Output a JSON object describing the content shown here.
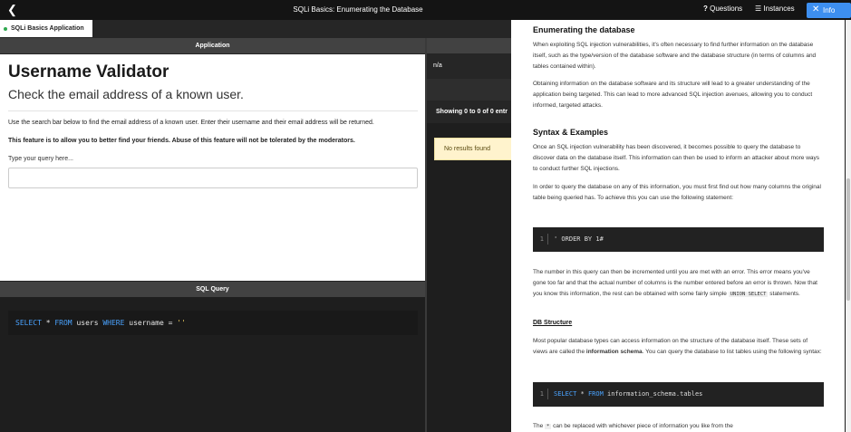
{
  "topbar": {
    "title": "SQLi Basics: Enumerating the Database",
    "questions_label": "Questions",
    "instances_label": "Instances",
    "info_label": "Info"
  },
  "app_tab": {
    "label": "SQLi Basics Application",
    "status_color": "#2fa84f"
  },
  "application": {
    "header": "Application",
    "heading": "Username Validator",
    "subheading": "Check the email address of a known user.",
    "description": "Use the search bar below to find the email address of a known user. Enter their username and their email address will be returned.",
    "warning": "This feature is to allow you to better find your friends. Abuse of this feature will not be tolerated by the moderators.",
    "input_label": "Type your query here...",
    "input_value": ""
  },
  "sql_query": {
    "header": "SQL Query",
    "kw_select": "SELECT",
    "star": " * ",
    "kw_from": "FROM",
    "table": " users ",
    "kw_where": "WHERE",
    "cond": " username = ",
    "literal": "''"
  },
  "results": {
    "na_label": "n/a",
    "showing": "Showing 0 to 0 of 0 entr",
    "no_results": "No results found"
  },
  "info": {
    "title": "Enumerating the database",
    "para1": "When exploiting SQL injection vulnerabilities, it's often necessary to find further information on the database itself, such as the type/version of the database software and the database structure (in terms of columns and tables contained within).",
    "para2": "Obtaining information on the database software and its structure will lead to a greater understanding of the application being targeted. This can lead to more advanced SQL injection avenues, allowing you to conduct informed, targeted attacks.",
    "syntax_title": "Syntax & Examples",
    "para3": "Once an SQL injection vulnerability has been discovered, it becomes possible to query the database to discover data on the database itself. This information can then be used to inform an attacker about more ways to conduct further SQL injections.",
    "para4": "In order to query the database on any of this information, you must first find out how many columns the original table being queried has. To achieve this you can use the following statement:",
    "code1_line": "1",
    "code1": "' ORDER BY 1#",
    "para5_a": "The number in this query can then be incremented until you are met with an error. This error means you've gone too far and that the actual number of columns is the number entered before an error is thrown. Now that you know this information, the rest can be obtained with some fairly simple",
    "para5_code": "UNION SELECT",
    "para5_b": "statements.",
    "db_structure": "DB Structure",
    "para6_a": "Most popular database types can access information on the structure of the database itself. These sets of views are called the",
    "para6_bold": "information schema",
    "para6_b": ". You can query the database to list tables using the following syntax:",
    "code2_line": "1",
    "code2_kw1": "SELECT",
    "code2_star": " * ",
    "code2_kw2": "FROM",
    "code2_rest": " information_schema.tables",
    "para7_a": "The",
    "para7_code": "*",
    "para7_b": "can be replaced with whichever piece of information you like from the"
  }
}
